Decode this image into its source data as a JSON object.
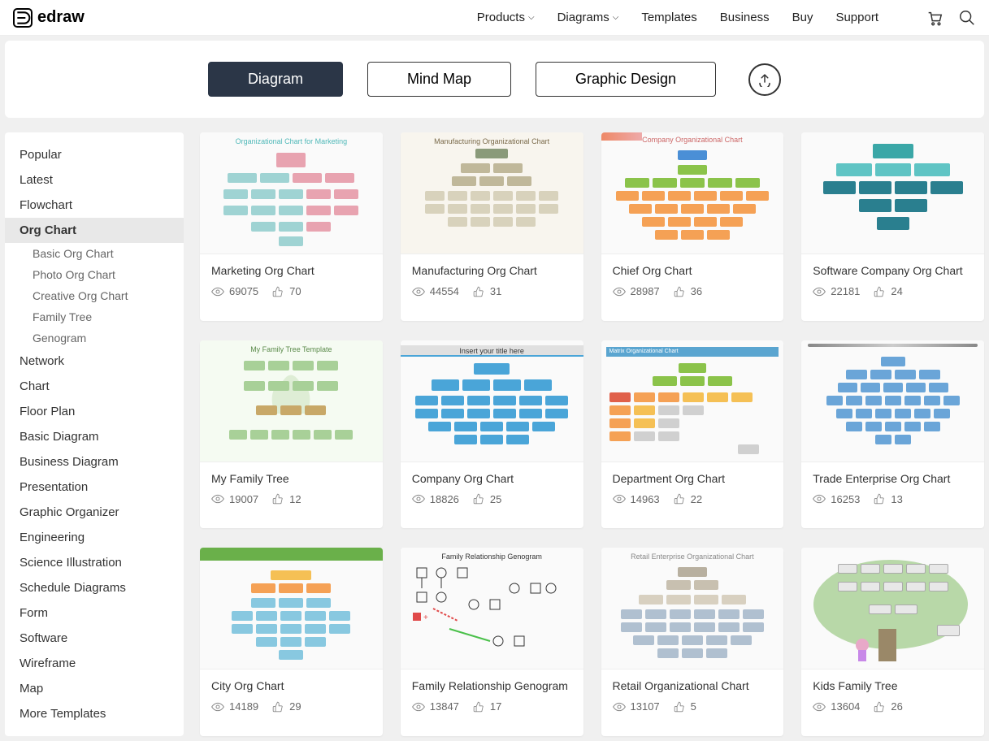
{
  "header": {
    "logo": "edraw",
    "nav": [
      "Products",
      "Diagrams",
      "Templates",
      "Business",
      "Buy",
      "Support"
    ],
    "nav_dropdown": [
      true,
      true,
      false,
      false,
      false,
      false
    ]
  },
  "tabs": {
    "items": [
      "Diagram",
      "Mind Map",
      "Graphic Design"
    ],
    "active": 0
  },
  "sidebar": {
    "items": [
      "Popular",
      "Latest",
      "Flowchart",
      "Org Chart",
      "Network",
      "Chart",
      "Floor Plan",
      "Basic Diagram",
      "Business Diagram",
      "Presentation",
      "Graphic Organizer",
      "Engineering",
      "Science Illustration",
      "Schedule Diagrams",
      "Form",
      "Software",
      "Wireframe",
      "Map",
      "More Templates"
    ],
    "active": "Org Chart",
    "sub": [
      "Basic Org Chart",
      "Photo Org Chart",
      "Creative Org Chart",
      "Family Tree",
      "Genogram"
    ]
  },
  "cards": [
    {
      "title": "Marketing Org Chart",
      "views": "69075",
      "likes": "70"
    },
    {
      "title": "Manufacturing Org Chart",
      "views": "44554",
      "likes": "31"
    },
    {
      "title": "Chief Org Chart",
      "views": "28987",
      "likes": "36"
    },
    {
      "title": "Software Company Org Chart",
      "views": "22181",
      "likes": "24"
    },
    {
      "title": "My Family Tree",
      "views": "19007",
      "likes": "12"
    },
    {
      "title": "Company Org Chart",
      "views": "18826",
      "likes": "25"
    },
    {
      "title": "Department Org Chart",
      "views": "14963",
      "likes": "22"
    },
    {
      "title": "Trade Enterprise Org Chart",
      "views": "16253",
      "likes": "13"
    },
    {
      "title": "City Org Chart",
      "views": "14189",
      "likes": "29"
    },
    {
      "title": "Family Relationship Genogram",
      "views": "13847",
      "likes": "17"
    },
    {
      "title": "Retail Organizational Chart",
      "views": "13107",
      "likes": "5"
    },
    {
      "title": "Kids Family Tree",
      "views": "13604",
      "likes": "26"
    }
  ],
  "thumb_labels": {
    "marketing": "Organizational Chart for Marketing",
    "manufacturing": "Manufacturing Organizational Chart",
    "chief": "Company Organizational Chart",
    "family": "My Family Tree Template",
    "company": "Insert your title here",
    "dept": "Matrix Organizational Chart",
    "genogram": "Family Relationship Genogram",
    "retail": "Retail Enterprise Organizational Chart"
  }
}
